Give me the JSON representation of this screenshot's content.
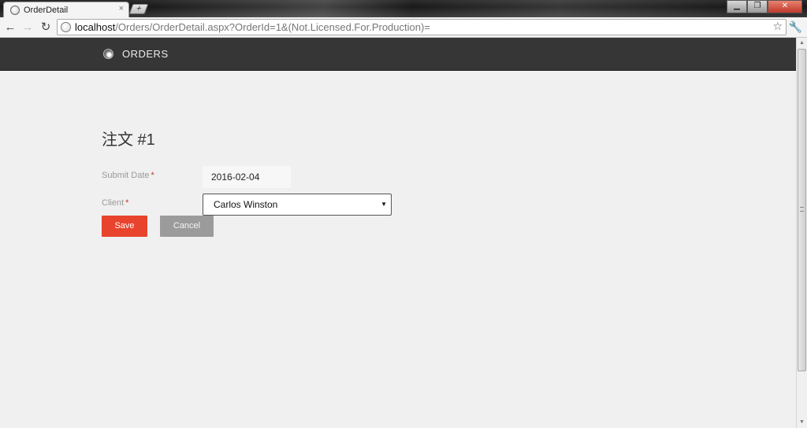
{
  "browser": {
    "tab_title": "OrderDetail",
    "tab_close": "×",
    "new_tab": "+",
    "url_host": "localhost",
    "url_path": "/Orders/OrderDetail.aspx?OrderId=1&(Not.Licensed.For.Production)=",
    "controls": {
      "minimize": "▁",
      "maximize": "❐",
      "close": "✕"
    },
    "back_icon": "arrow-left",
    "forward_icon": "arrow-right",
    "reload_icon": "reload",
    "star_icon": "star",
    "wrench_icon": "wrench"
  },
  "navbar": {
    "brand": "ORDERS",
    "background": "#363636"
  },
  "page": {
    "title": "注文 #1"
  },
  "form": {
    "submit_date": {
      "label": "Submit Date",
      "required_mark": "*",
      "value": "2016-02-04"
    },
    "client": {
      "label": "Client",
      "required_mark": "*",
      "selected": "Carlos Winston"
    }
  },
  "buttons": {
    "save": "Save",
    "cancel": "Cancel",
    "save_color": "#e8432d",
    "cancel_color": "#9b9b9b"
  }
}
